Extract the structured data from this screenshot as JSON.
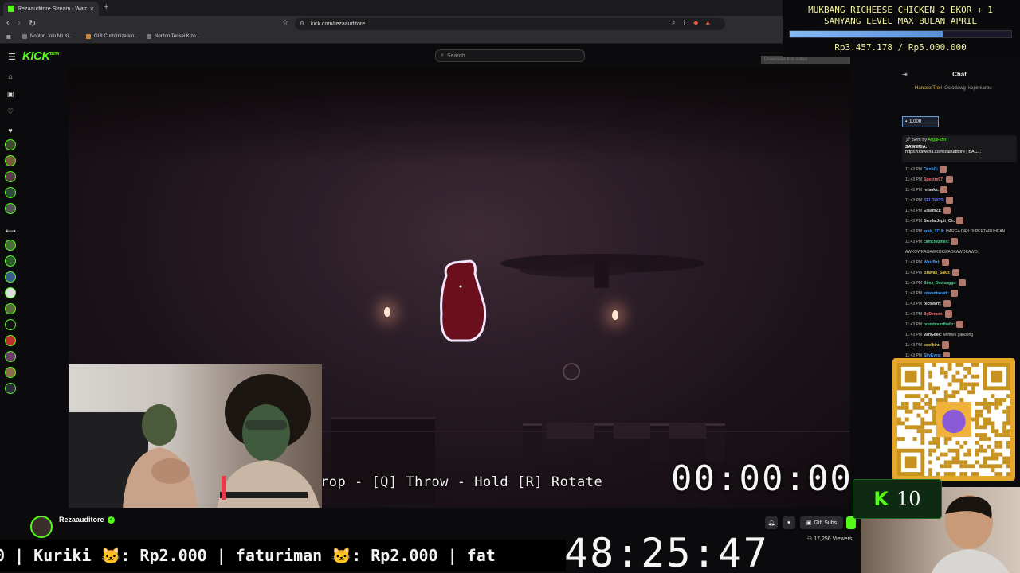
{
  "browser": {
    "tab_title": "Rezaauditore Stream - Watch",
    "url": "kick.com/rezaauditore",
    "bookmarks": [
      "Nonton Jolo No Ki...",
      "GUI Customization...",
      "Nonton Tensei Kizo..."
    ]
  },
  "header": {
    "logo": "KICK",
    "logo_badge": "BETA",
    "search_placeholder": "Search",
    "download_hint": "Download this video"
  },
  "game": {
    "controls_hint": "rop - [Q] Throw - Hold [R] Rotate",
    "timer": "00:00:00"
  },
  "streamer": {
    "name": "Rezaauditore",
    "gift_subs_label": "Gift Subs",
    "viewers": "17,256 Viewers"
  },
  "ticker": {
    "text": "0 | Kuriki 🐱: Rp2.000 | faturiman 🐱: Rp2.000 | fat",
    "big_timer": "48:25:47"
  },
  "goal": {
    "title_line1": "MUKBANG RICHEESE CHICKEN 2 EKOR + 1",
    "title_line2": "SAMYANG LEVEL MAX BULAN APRIL",
    "amount": "Rp3.457.178 / Rp5.000.000",
    "progress_fraction": 0.69
  },
  "chat": {
    "title": "Chat",
    "top_gifters": [
      "HansserTroll",
      "Oslodawg",
      "kepinkarbu"
    ],
    "gift_count": "1,000",
    "pinned": {
      "sent_by": "Sent by",
      "sender": "ArgaHden",
      "title": "SAWERIA:",
      "link": "https://saweria.co/rezaauditore | BAC..."
    },
    "messages": [
      {
        "time": "11:43 PM",
        "user": "Ocebl3:",
        "color": "#4aa3ff",
        "text": ""
      },
      {
        "time": "11:43 PM",
        "user": "Spectre07:",
        "color": "#ff6b6b",
        "text": ""
      },
      {
        "time": "11:43 PM",
        "user": "refanks:",
        "color": "#dddddd",
        "text": ""
      },
      {
        "time": "11:43 PM",
        "user": "SELOW2S:",
        "color": "#6b7bff",
        "text": ""
      },
      {
        "time": "11:43 PM",
        "user": "Ersam21:",
        "color": "#dddddd",
        "text": ""
      },
      {
        "time": "11:43 PM",
        "user": "SendalJepit_Ch:",
        "color": "#dddddd",
        "text": ""
      },
      {
        "time": "11:43 PM",
        "user": "arab_2710:",
        "color": "#4aa3ff",
        "text": "HARGA DIRI DI PERTARUHKAN"
      },
      {
        "time": "11:43 PM",
        "user": "camcloumen:",
        "color": "#4ad08a",
        "text": ""
      },
      {
        "time": "",
        "user": "",
        "color": "#dddddd",
        "text": "AWKOWKAOAWKOKWAOKAWOKAWO."
      },
      {
        "time": "11:43 PM",
        "user": "WatzBzl:",
        "color": "#4aa3ff",
        "text": ""
      },
      {
        "time": "11:43 PM",
        "user": "Blawak_Sakti:",
        "color": "#e6c84a",
        "text": ""
      },
      {
        "time": "11:43 PM",
        "user": "Bima_Dewangga:",
        "color": "#4ad08a",
        "text": ""
      },
      {
        "time": "11:43 PM",
        "user": "edwantasudi:",
        "color": "#4aa3ff",
        "text": ""
      },
      {
        "time": "11:43 PM",
        "user": "tectowrn:",
        "color": "#dddddd",
        "text": ""
      },
      {
        "time": "11:43 PM",
        "user": "ByDemon:",
        "color": "#ff6b6b",
        "text": ""
      },
      {
        "time": "11:43 PM",
        "user": "ndmdmurdhafiz:",
        "color": "#4ad08a",
        "text": ""
      },
      {
        "time": "11:43 PM",
        "user": "VanGeek:",
        "color": "#dddddd",
        "text": "Memek gandeng"
      },
      {
        "time": "11:43 PM",
        "user": "boolbirz:",
        "color": "#e6c84a",
        "text": ""
      },
      {
        "time": "11:43 PM",
        "user": "SkyEyes:",
        "color": "#4aa3ff",
        "text": ""
      }
    ]
  },
  "kick_counter": {
    "icon": "K",
    "count": "10"
  },
  "colors": {
    "kick_green": "#53fc18",
    "goal_text": "#f1f1a0"
  }
}
